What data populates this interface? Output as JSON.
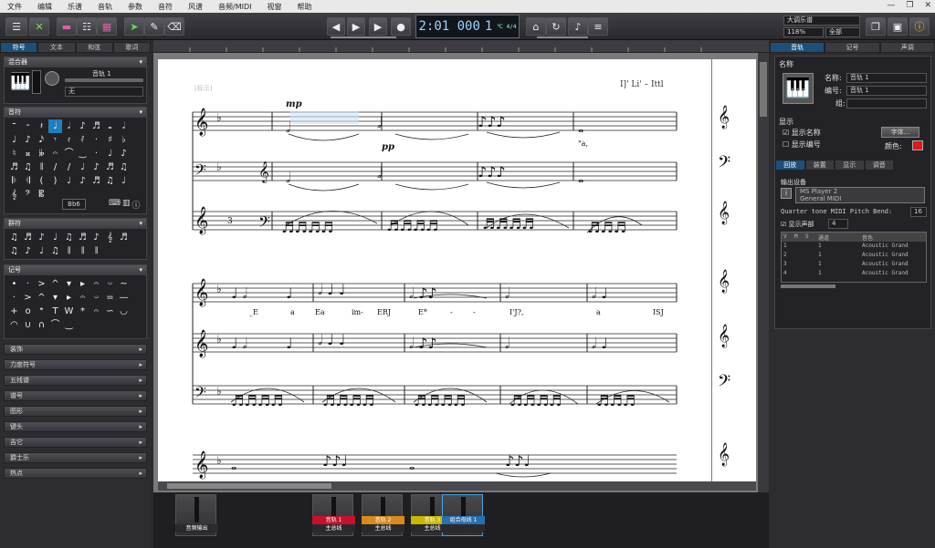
{
  "menu": [
    "文件",
    "编辑",
    "乐谱",
    "音轨",
    "参数",
    "音符",
    "风谱",
    "音频/MIDI",
    "视窗",
    "帮助"
  ],
  "window_controls": [
    "—",
    "❐",
    "✕"
  ],
  "transport": {
    "time_display": "2:01 000",
    "bar_beat": "1",
    "tempo_small": "℃ 4/4"
  },
  "toolbar_right": {
    "instrument_select": "大调乐谱",
    "zoom_select": "118%",
    "view_select": "全部"
  },
  "left_panel": {
    "tabs": [
      "符号",
      "文本",
      "和弦",
      "歌词"
    ],
    "mixer_section": {
      "title": "混合器",
      "track_name": "音轨 1",
      "channel_name": "无"
    },
    "notes_section": {
      "title": "音符",
      "glyphs": [
        "𝄻",
        "𝄼",
        "𝄽",
        "♩",
        "𝅗𝅥",
        "♪",
        "♬",
        "𝅝",
        "𝅗𝅥",
        "♩",
        "♪",
        "𝅘𝅥𝅯",
        "𝄾",
        "𝄿",
        "𝅀",
        "·",
        "♯",
        "♭",
        "♮",
        "𝄪",
        "𝄫",
        "𝄐",
        "⌒",
        "‿",
        "·",
        "♩",
        "♪",
        "♬",
        "♫",
        "𝄂",
        "/",
        "/",
        "♩",
        "♪",
        "♬",
        "♫",
        "𝄆",
        "𝄇",
        "(",
        ")",
        "♩",
        "♪",
        "♬",
        "♫",
        "♩",
        "𝄞",
        "𝄢",
        "𝄡"
      ],
      "key_label": "Bb6"
    },
    "beams_section": {
      "title": "群符",
      "glyphs": [
        "♫",
        "♬",
        "♪",
        "♩",
        "♫",
        "♬",
        "♪",
        "𝄞",
        "♬",
        "♫",
        "♪",
        "♩",
        "♫",
        "𝄂",
        "𝄂",
        "𝄂"
      ]
    },
    "marks_section": {
      "title": "记号",
      "glyphs": [
        "•",
        "·",
        ">",
        "^",
        "▾",
        "▸",
        "𝄐",
        "𝄑",
        "~",
        "·",
        ">",
        "^",
        "▾",
        "▸",
        "𝄐",
        "𝄑",
        "=",
        "—",
        "+",
        "o",
        "𝄌",
        "T",
        "W",
        "*",
        "𝄐",
        "∽",
        "◡",
        "◠",
        "∪",
        "∩",
        "⌒",
        "‿"
      ]
    },
    "collapsed_sections": [
      "装饰",
      "力度符号",
      "五线谱",
      "谱号",
      "图形",
      "键头",
      "吉它",
      "爵士乐",
      "热点"
    ]
  },
  "score": {
    "header_left": "[标示]",
    "header_right": "I]' Li' – Ittl",
    "dynamics": [
      "mp",
      "pp"
    ],
    "lyrics_row1": [
      "_E",
      "a",
      "Ea",
      "im-",
      "ERJ",
      "E*",
      "-",
      "-",
      "I'J?,",
      "a",
      "ISJ"
    ],
    "lyric_fragment": "\"a,"
  },
  "right_panel": {
    "tabs": [
      "音轨",
      "记号",
      "声调"
    ],
    "name_section": {
      "title": "名称",
      "name_label": "名称:",
      "name_value": "音轨 1",
      "number_label": "编号:",
      "number_value": "音轨 1",
      "group_label": "组:",
      "group_value": ""
    },
    "display_section": {
      "title": "显示",
      "show_name": "显示名称",
      "show_number": "显示编号",
      "font_button": "字体...",
      "color_label": "颜色:",
      "color_value": "#e01818"
    },
    "sub_tabs": [
      "回放",
      "装置",
      "显示",
      "调音"
    ],
    "output_section": {
      "title": "输出设备",
      "device_line1": "MS Player 2",
      "device_line2": "General MIDI",
      "pitch_bend_label": "Quarter tone MIDI Pitch Bend:",
      "pitch_bend_value": "16",
      "show_voices": "显示声部",
      "voices_value": "4",
      "table_headers": [
        "V",
        "M",
        "S",
        "通道",
        "音色"
      ],
      "table_rows": [
        [
          "1",
          "",
          "",
          "1",
          "Acoustic Grand"
        ],
        [
          "2",
          "",
          "",
          "1",
          "Acoustic Grand"
        ],
        [
          "3",
          "",
          "",
          "1",
          "Acoustic Grand"
        ],
        [
          "4",
          "",
          "",
          "1",
          "Acoustic Grand"
        ]
      ]
    }
  },
  "mixer": {
    "output_strip": "音频输出",
    "strips": [
      {
        "top": "音轨 1",
        "bottom": "主总线",
        "color": "#c8102e"
      },
      {
        "top": "音轨 2",
        "bottom": "主总线",
        "color": "#d98a1c"
      },
      {
        "top": "音轨 3",
        "bottom": "主总线",
        "color": "#c8b800"
      },
      {
        "top": "组合母线 1",
        "bottom": "",
        "color": "#2a6fb0"
      }
    ]
  },
  "colors": {
    "accent": "#1e4f78",
    "panel": "#2d2d31",
    "paper": "#ffffff"
  }
}
